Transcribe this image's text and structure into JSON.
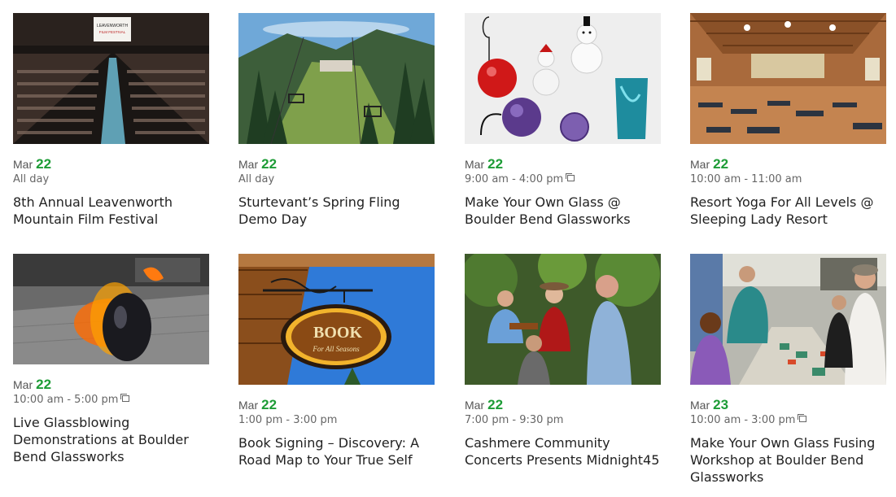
{
  "events": [
    {
      "month": "Mar",
      "day": "22",
      "time": "All day",
      "recurring": false,
      "title": "8th Annual Leavenworth Mountain Film Festival"
    },
    {
      "month": "Mar",
      "day": "22",
      "time": "All day",
      "recurring": false,
      "title": "Sturtevant’s Spring Fling Demo Day"
    },
    {
      "month": "Mar",
      "day": "22",
      "time": "9:00 am - 4:00 pm",
      "recurring": true,
      "title": "Make Your Own Glass @ Boulder Bend Glassworks"
    },
    {
      "month": "Mar",
      "day": "22",
      "time": "10:00 am - 11:00 am",
      "recurring": false,
      "title": "Resort Yoga For All Levels @ Sleeping Lady Resort"
    },
    {
      "month": "Mar",
      "day": "22",
      "time": "10:00 am - 5:00 pm",
      "recurring": true,
      "title": "Live Glassblowing Demonstrations at Boulder Bend Glassworks"
    },
    {
      "month": "Mar",
      "day": "22",
      "time": "1:00 pm - 3:00 pm",
      "recurring": false,
      "title": "Book Signing – Discovery: A Road Map to Your True Self"
    },
    {
      "month": "Mar",
      "day": "22",
      "time": "7:00 pm - 9:30 pm",
      "recurring": false,
      "title": "Cashmere Community Concerts Presents Midnight45"
    },
    {
      "month": "Mar",
      "day": "23",
      "time": "10:00 am - 3:00 pm",
      "recurring": true,
      "title": "Make Your Own Glass Fusing Workshop at Boulder Bend Glassworks"
    }
  ],
  "images": {
    "screen_text_1": "LEAVENWORTH",
    "screen_text_2": "FILM FESTIVAL",
    "sign_text_1": "BOOK",
    "sign_text_2": "For All Seasons"
  },
  "colors": {
    "day_accent": "#1d9c36",
    "title": "#222222",
    "meta": "#666666"
  }
}
